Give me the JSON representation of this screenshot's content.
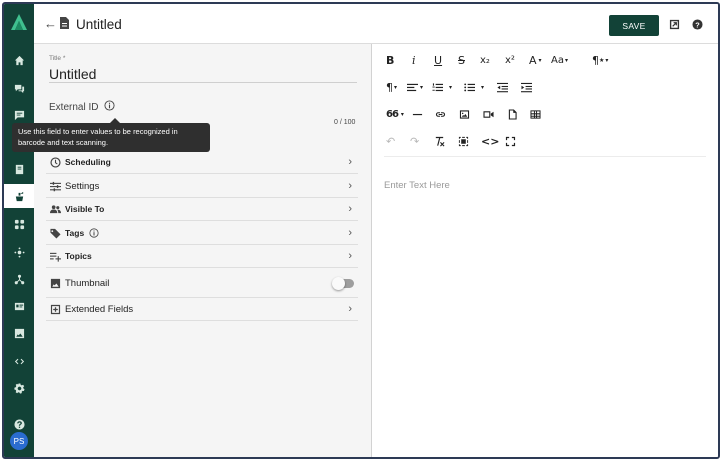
{
  "header": {
    "back_icon": "arrow-left-icon",
    "doc_icon": "document-icon",
    "title": "Untitled",
    "save_label": "SAVE",
    "share_icon": "open-in-new-icon",
    "help_icon": "help-circle-icon"
  },
  "rail": {
    "items": [
      "home-icon",
      "comments-icon",
      "chat-icon",
      "book-icon",
      "sidebar-item-active-icon",
      "apps-icon",
      "hub-icon",
      "network-icon",
      "id-card-icon",
      "image-icon",
      "code-icon",
      "settings-icon",
      "help-icon"
    ],
    "avatar": "PS",
    "brand_color": "#124237"
  },
  "form": {
    "title_label": "Title *",
    "title_value": "Untitled",
    "external_id_label": "External ID",
    "counter": "0 / 100",
    "tooltip": "Use this field to enter values to be recognized in barcode and text scanning.",
    "rows": [
      {
        "label": "Scheduling",
        "icon": "clock-icon"
      },
      {
        "label": "Settings",
        "icon": "sliders-icon"
      },
      {
        "label": "Visible To",
        "icon": "people-icon"
      },
      {
        "label": "Tags",
        "icon": "tag-icon"
      },
      {
        "label": "Topics",
        "icon": "topics-icon"
      },
      {
        "label": "Thumbnail",
        "icon": "image-icon"
      },
      {
        "label": "Extended Fields",
        "icon": "extended-fields-icon"
      }
    ]
  },
  "editor": {
    "placeholder": "Enter Text Here",
    "toolbar": {
      "bold": "B",
      "italic": "i",
      "underline": "U",
      "strike": "S",
      "subscript": "x₂",
      "superscript": "x²",
      "font_color": "A",
      "font_size": "Aa",
      "paragraph_format": "¶",
      "quote": "66",
      "undo": "↶",
      "redo": "↷",
      "code": "<>"
    }
  }
}
